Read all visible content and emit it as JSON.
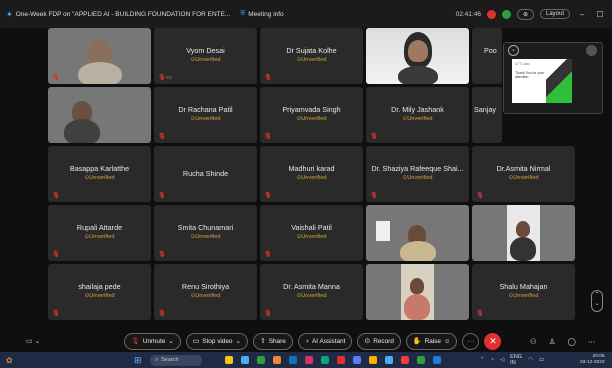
{
  "window": {
    "meeting_title": "One-Week FDP on \"APPLIED AI - BUILDING FOUNDATION FOR ENTE...",
    "info_label": "Meeting info",
    "timer": "02:41:46",
    "layout_label": "Layout"
  },
  "participants": [
    {
      "name": "",
      "status": "",
      "video": true
    },
    {
      "name": "Vyom Desai",
      "status": "Unverified",
      "video": false
    },
    {
      "name": "Dr Sujata Kolhe",
      "status": "Unverified",
      "video": false
    },
    {
      "name": "",
      "status": "",
      "video": true
    },
    {
      "name": "Poo",
      "status": "",
      "video": false
    },
    {
      "name": "",
      "status": "",
      "video": true
    },
    {
      "name": "Dr Rachana Patil",
      "status": "Unverified",
      "video": false
    },
    {
      "name": "Priyamvada Singh",
      "status": "Unverified",
      "video": false
    },
    {
      "name": "Dr. Mily Jashank",
      "status": "Unverified",
      "video": false
    },
    {
      "name": "Sanjay",
      "status": "",
      "video": false
    },
    {
      "name": "Basappa Karlatthe",
      "status": "Unverified",
      "video": false
    },
    {
      "name": "Rucha Shinde",
      "status": "",
      "video": false
    },
    {
      "name": "Madhuri karad",
      "status": "Unverified",
      "video": false
    },
    {
      "name": "Dr. Shaziya Rafeeque Shai...",
      "status": "Unverified",
      "video": false
    },
    {
      "name": "Dr.Asmita Nirmal",
      "status": "Unverified",
      "video": false
    },
    {
      "name": "Rupali Attarde",
      "status": "Unverified",
      "video": false
    },
    {
      "name": "Smita Chunamari",
      "status": "Unverified",
      "video": false
    },
    {
      "name": "Vaishali Patil",
      "status": "Unverified",
      "video": false
    },
    {
      "name": "",
      "status": "",
      "video": true
    },
    {
      "name": "",
      "status": "",
      "video": true
    },
    {
      "name": "shailaja pede",
      "status": "Unverified",
      "video": false
    },
    {
      "name": "Renu Sirothiya",
      "status": "Unverified",
      "video": false
    },
    {
      "name": "Dr. Asmita Manna",
      "status": "Unverified",
      "video": false
    },
    {
      "name": "",
      "status": "",
      "video": true
    },
    {
      "name": "Shalu Mahajan",
      "status": "Unverified",
      "video": false
    }
  ],
  "share_preview": {
    "slide_title": "ATT Labs",
    "slide_text": "Thank You for your attention"
  },
  "toolbar": {
    "unmute": "Unmute",
    "stop_video": "Stop video",
    "share": "Share",
    "ai_assistant": "AI Assistant",
    "record": "Record",
    "raise": "Raise"
  },
  "taskbar": {
    "search": "Search",
    "lang": "ENG",
    "region": "IN",
    "time": "20:06",
    "date": "03-12-2023"
  },
  "colors": {
    "unverified": "#d9a23b",
    "muted_mic": "#e03131",
    "leave": "#e03131"
  }
}
